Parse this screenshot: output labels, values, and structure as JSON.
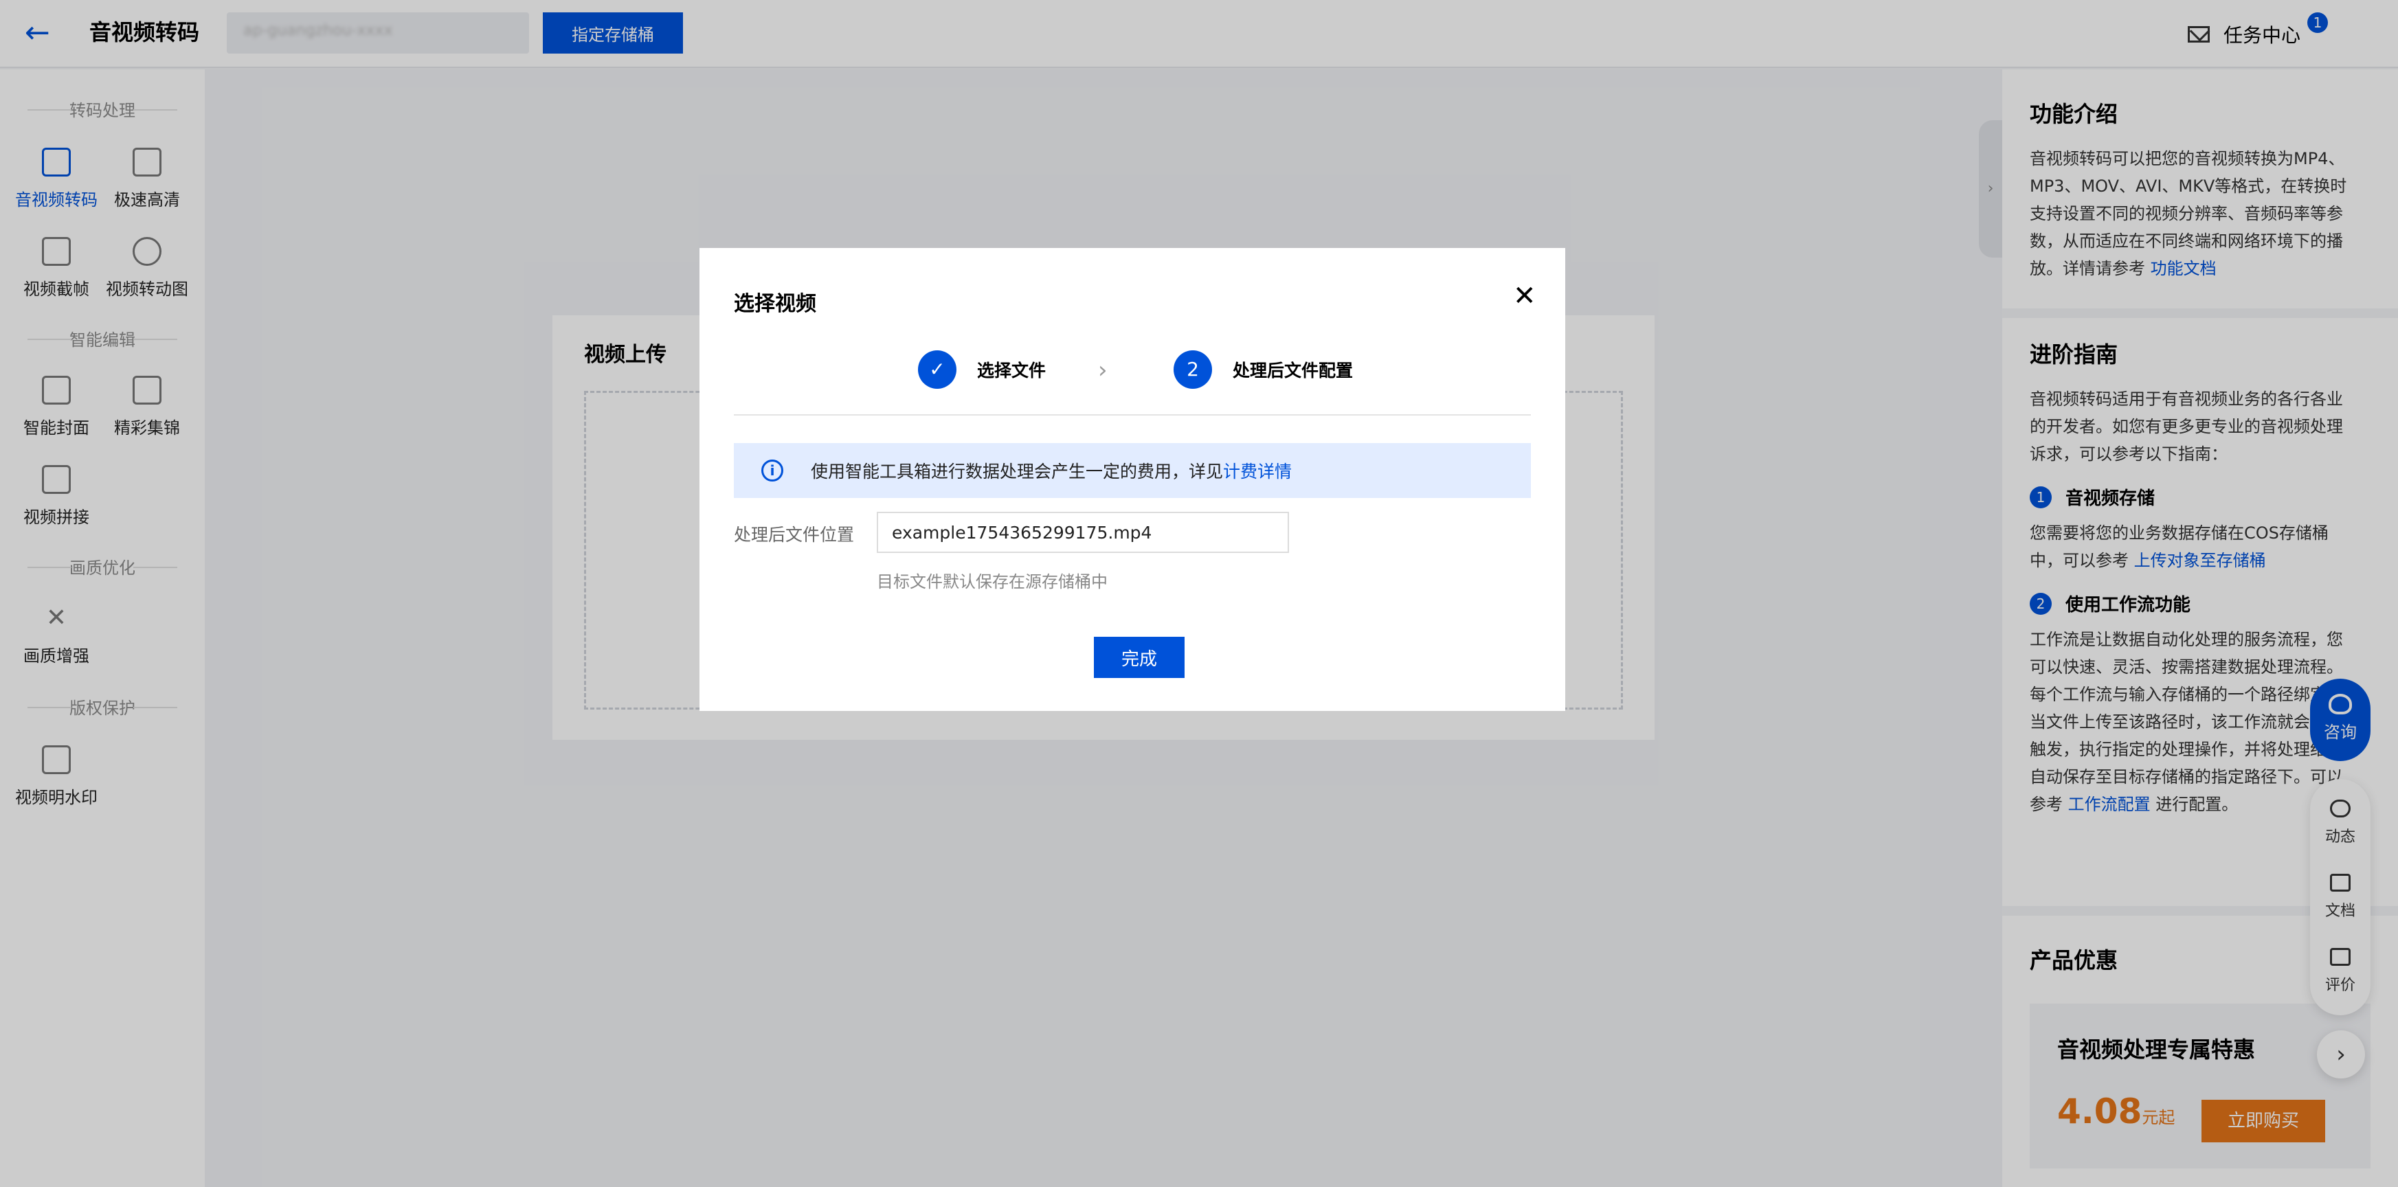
{
  "header": {
    "back_icon": "arrow-left-icon",
    "title": "音视频转码",
    "assign_button": "指定存储桶",
    "task_center": "任务中心",
    "task_badge": "1"
  },
  "left_nav": {
    "groups": [
      {
        "title": "转码处理",
        "items": [
          "音视频转码",
          "极速高清",
          "视频截帧",
          "视频转动图"
        ]
      },
      {
        "title": "智能编辑",
        "items": [
          "智能封面",
          "精彩集锦",
          "视频拼接"
        ]
      },
      {
        "title": "画质优化",
        "items": [
          "画质增强"
        ]
      },
      {
        "title": "版权保护",
        "items": [
          "视频明水印"
        ]
      }
    ]
  },
  "main": {
    "upload_title": "视频上传"
  },
  "right_panel": {
    "intro_title": "功能介绍",
    "intro_text": "音视频转码可以把您的音视频转换为MP4、MP3、MOV、AVI、MKV等格式，在转换时支持设置不同的视频分辨率、音频码率等参数，从而适应在不同终端和网络环境下的播放。详情请参考 ",
    "intro_link": "功能文档",
    "guide_title": "进阶指南",
    "guide_text": "音视频转码适用于有音视频业务的各行各业的开发者。如您有更多更专业的音视频处理诉求，可以参考以下指南：",
    "guide_items": [
      {
        "num": "1",
        "title": "音视频存储",
        "text": "您需要将您的业务数据存储在COS存储桶中，可以参考 ",
        "link": "上传对象至存储桶",
        "after": ""
      },
      {
        "num": "2",
        "title": "使用工作流功能",
        "text": "工作流是让数据自动化处理的服务流程，您可以快速、灵活、按需搭建数据处理流程。每个工作流与输入存储桶的一个路径绑定，当文件上传至该路径时，该工作流就会自动触发，执行指定的处理操作，并将处理结果自动保存至目标存储桶的指定路径下。可以参考 ",
        "link": "工作流配置",
        "after": " 进行配置。"
      }
    ],
    "promo_section": "产品优惠",
    "promo_title": "音视频处理专属特惠",
    "promo_price": "4.08",
    "promo_unit": "元起",
    "promo_buy": "立即购买"
  },
  "float_tools": {
    "consult": "咨询",
    "tools": [
      "动态",
      "文档",
      "评价"
    ]
  },
  "modal": {
    "title": "选择视频",
    "steps": [
      {
        "label": "选择文件",
        "state": "done"
      },
      {
        "num": "2",
        "label": "处理后文件配置",
        "state": "active"
      }
    ],
    "alert_text": "使用智能工具箱进行数据处理会产生一定的费用，详见",
    "alert_link": "计费详情",
    "field_label": "处理后文件位置",
    "field_value": "example1754365299175.mp4",
    "field_help": "目标文件默认保存在源存储桶中",
    "done_button": "完成"
  },
  "colors": {
    "primary": "#0052d9",
    "warning": "#e37318",
    "alert_bg": "#e2ecff"
  }
}
